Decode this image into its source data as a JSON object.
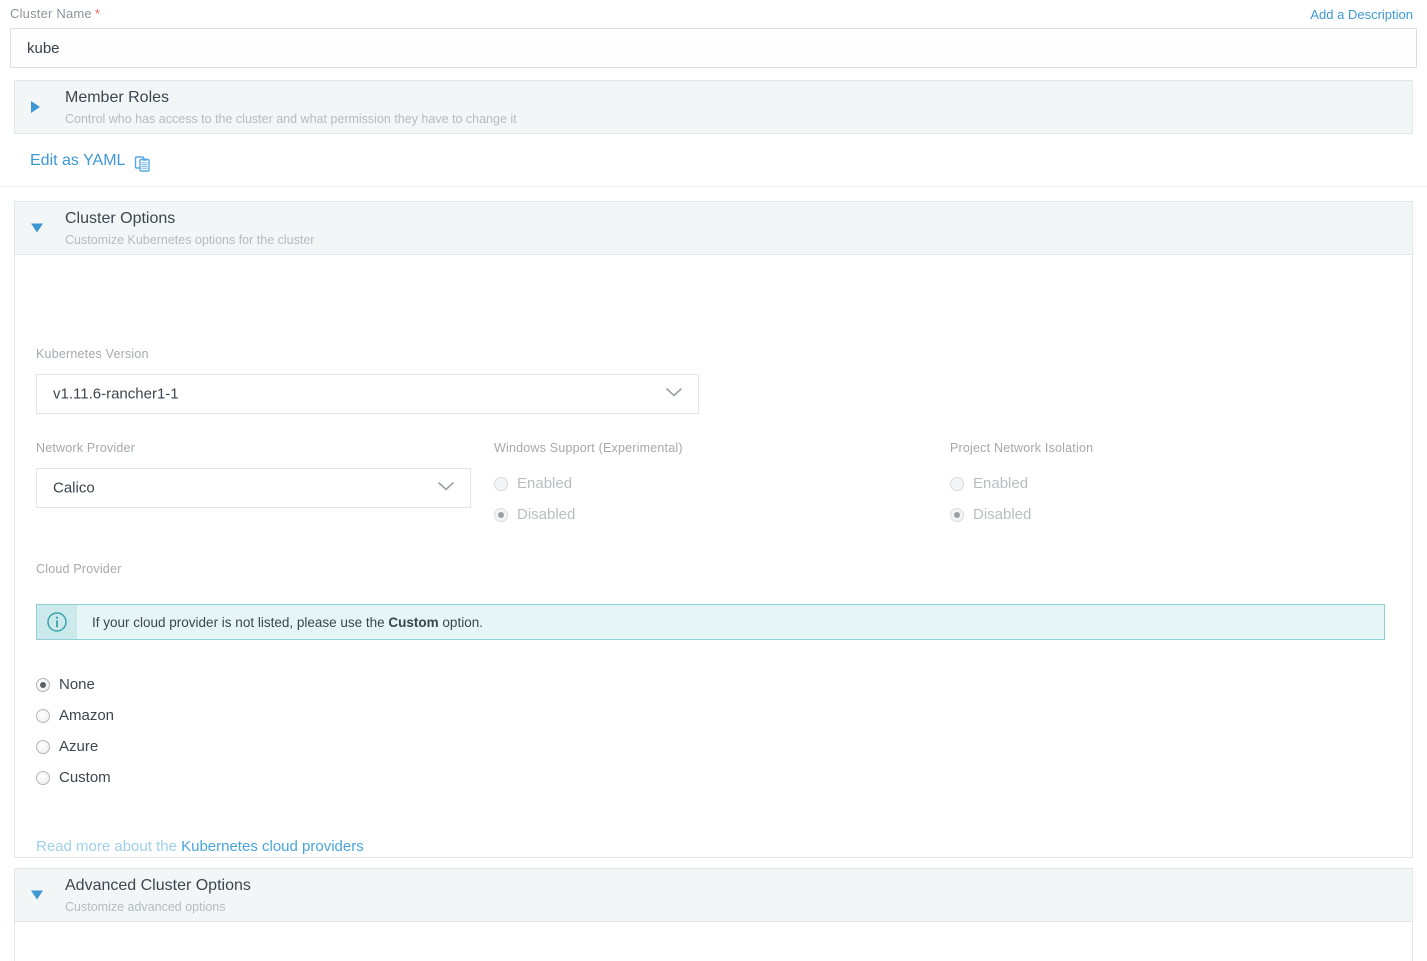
{
  "cluster_name": {
    "label": "Cluster Name",
    "required_mark": "*",
    "value": "kube",
    "add_description_link": "Add a Description"
  },
  "member_roles": {
    "title": "Member Roles",
    "subtitle": "Control who has access to the cluster and what permission they have to change it",
    "expanded": false,
    "caret_icon": "caret-right-icon"
  },
  "yaml": {
    "label": "Edit as YAML",
    "icon": "clipboard-copy-icon"
  },
  "cluster_options": {
    "title": "Cluster Options",
    "subtitle": "Customize Kubernetes options for the cluster",
    "expanded": true,
    "caret_icon": "caret-down-icon",
    "kubernetes_version": {
      "label": "Kubernetes Version",
      "value": "v1.11.6-rancher1-1",
      "chevron_icon": "chevron-down-icon"
    },
    "network_provider": {
      "label": "Network Provider",
      "value": "Calico",
      "chevron_icon": "chevron-down-icon"
    },
    "windows_support": {
      "label": "Windows Support (Experimental)",
      "disabled": true,
      "options": [
        {
          "label": "Enabled",
          "selected": false
        },
        {
          "label": "Disabled",
          "selected": true
        }
      ]
    },
    "project_network_isolation": {
      "label": "Project Network Isolation",
      "disabled": true,
      "options": [
        {
          "label": "Enabled",
          "selected": false
        },
        {
          "label": "Disabled",
          "selected": true
        }
      ]
    },
    "cloud_provider": {
      "label": "Cloud Provider",
      "banner": {
        "icon": "info-circle-icon",
        "text_before": "If your cloud provider is not listed, please use the ",
        "text_bold": "Custom",
        "text_after": " option."
      },
      "options": [
        {
          "label": "None",
          "selected": true
        },
        {
          "label": "Amazon",
          "selected": false
        },
        {
          "label": "Azure",
          "selected": false
        },
        {
          "label": "Custom",
          "selected": false
        }
      ],
      "read_more_prefix": "Read more about the ",
      "read_more_link": "Kubernetes cloud providers"
    }
  },
  "advanced_cluster_options": {
    "title": "Advanced Cluster Options",
    "subtitle": "Customize advanced options",
    "expanded": true,
    "caret_icon": "caret-down-icon"
  },
  "colors": {
    "link_blue": "#3d98d3",
    "caret_blue": "#3d98d3",
    "required_red": "#e8656f",
    "banner_border_teal": "#8fd0d6",
    "banner_bg_teal": "#e6f5f6",
    "section_header_bg": "#f3f6f7",
    "muted_text": "#a3a9ae"
  }
}
